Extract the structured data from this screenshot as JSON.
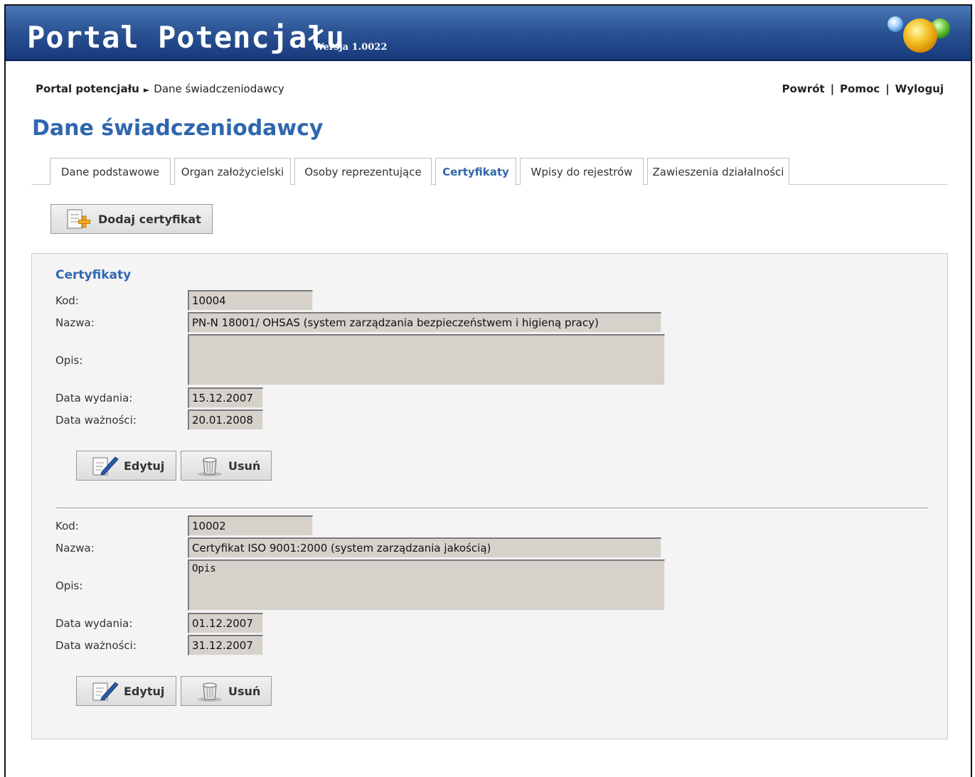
{
  "app": {
    "title": "Portal Potencjału",
    "version": "Wersja 1.0022"
  },
  "breadcrumb": {
    "root": "Portal potencjału",
    "separator": "►",
    "current": "Dane świadczeniodawcy"
  },
  "toplinks": {
    "back": "Powrót",
    "help": "Pomoc",
    "logout": "Wyloguj",
    "separator": "|"
  },
  "page": {
    "title": "Dane świadczeniodawcy"
  },
  "tabs": [
    {
      "label": "Dane podstawowe"
    },
    {
      "label": "Organ założycielski"
    },
    {
      "label": "Osoby reprezentujące"
    },
    {
      "label": "Certyfikaty",
      "active": true
    },
    {
      "label": "Wpisy do rejestrów"
    },
    {
      "label": "Zawieszenia działalności"
    }
  ],
  "add_button": {
    "label": "Dodaj certyfikat"
  },
  "panel": {
    "title": "Certyfikaty",
    "labels": {
      "code": "Kod:",
      "name": "Nazwa:",
      "description": "Opis:",
      "issue_date": "Data wydania:",
      "expiry_date": "Data ważności:"
    },
    "buttons": {
      "edit": "Edytuj",
      "delete": "Usuń"
    },
    "certificates": [
      {
        "code": "10004",
        "name": "PN-N 18001/ OHSAS (system zarządzania bezpieczeństwem i higieną pracy)",
        "description": "",
        "issue_date": "15.12.2007",
        "expiry_date": "20.01.2008"
      },
      {
        "code": "10002",
        "name": "Certyfikat ISO 9001:2000 (system zarządzania jakością)",
        "description": "Opis",
        "issue_date": "01.12.2007",
        "expiry_date": "31.12.2007"
      }
    ]
  },
  "colors": {
    "banner": "#2c5596",
    "accent": "#2f67ae",
    "field_bg": "#d6d2cb"
  }
}
